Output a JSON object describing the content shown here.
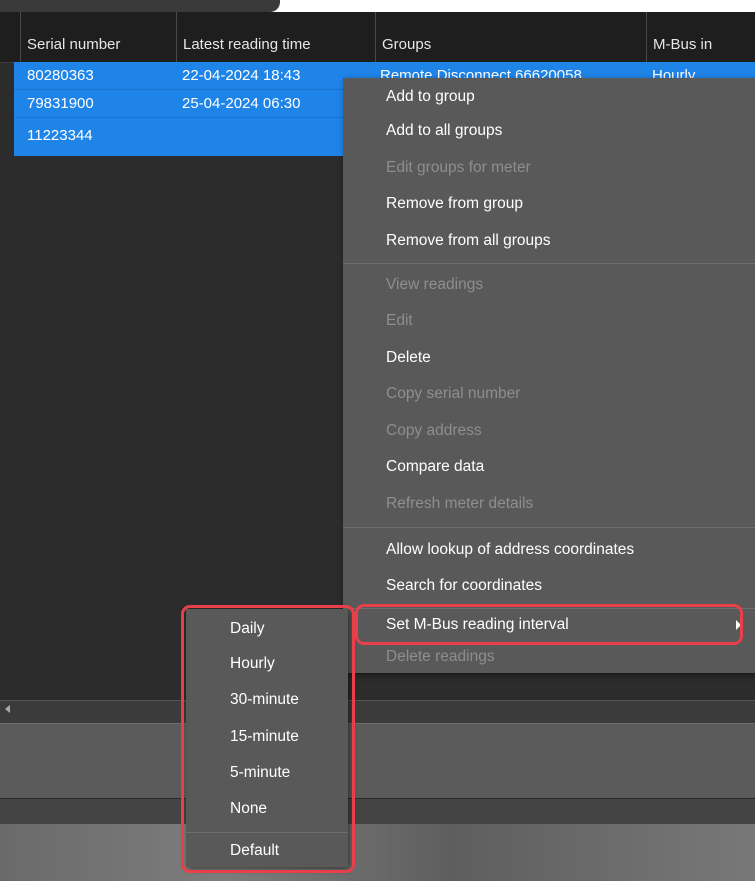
{
  "grid": {
    "columns": [
      "Serial number",
      "Latest reading time",
      "Groups",
      "M-Bus in"
    ],
    "rows": [
      {
        "serial": "80280363",
        "time": "22-04-2024 18:43",
        "groups": "Remote Disconnect 66620058",
        "mbus": "Hourly"
      },
      {
        "serial": "79831900",
        "time": "25-04-2024 06:30",
        "groups": "",
        "mbus": ""
      },
      {
        "serial": "11223344",
        "time": "",
        "groups": "",
        "mbus": ""
      }
    ]
  },
  "context_menu": {
    "items": [
      {
        "label": "Add to group",
        "enabled": true
      },
      {
        "label": "Add to all groups",
        "enabled": true
      },
      {
        "label": "Edit groups for meter",
        "enabled": false
      },
      {
        "label": "Remove from group",
        "enabled": true
      },
      {
        "label": "Remove from all groups",
        "enabled": true
      },
      {
        "label": "View readings",
        "enabled": false
      },
      {
        "label": "Edit",
        "enabled": false
      },
      {
        "label": "Delete",
        "enabled": true
      },
      {
        "label": "Copy serial number",
        "enabled": false
      },
      {
        "label": "Copy address",
        "enabled": false
      },
      {
        "label": "Compare data",
        "enabled": true
      },
      {
        "label": "Refresh meter details",
        "enabled": false
      },
      {
        "label": "Allow lookup of address coordinates",
        "enabled": true
      },
      {
        "label": "Search for coordinates",
        "enabled": true
      },
      {
        "label": "Set M-Bus reading interval",
        "enabled": true,
        "has_submenu": true,
        "highlighted": true
      },
      {
        "label": "Delete readings",
        "enabled": false
      }
    ]
  },
  "submenu": {
    "items": [
      {
        "label": "Daily"
      },
      {
        "label": "Hourly"
      },
      {
        "label": "30-minute"
      },
      {
        "label": "15-minute"
      },
      {
        "label": "5-minute"
      },
      {
        "label": "None"
      },
      {
        "label": "Default"
      }
    ]
  },
  "icons": {
    "scroll_left": "chevron-left-icon",
    "submenu_arrow": "chevron-right-icon"
  },
  "colors": {
    "selection": "#1f84e8",
    "menu_background": "#595959",
    "annotation_outline": "#e8404a",
    "disabled_text": "#8e8e8e"
  }
}
